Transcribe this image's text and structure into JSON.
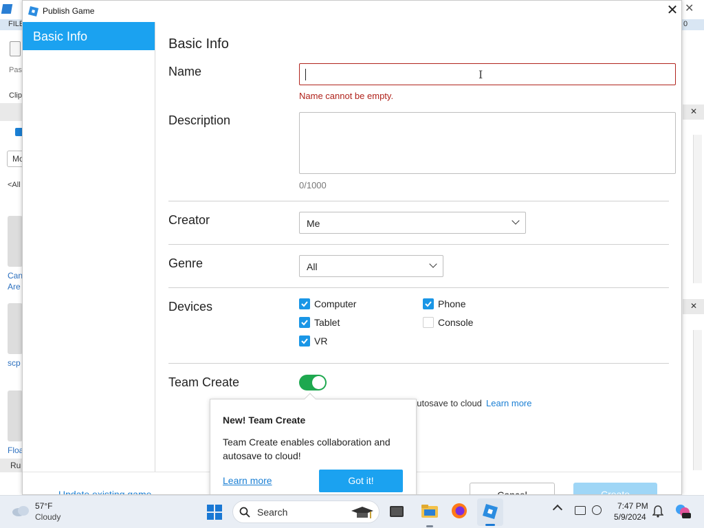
{
  "background": {
    "menu_file": "FILE",
    "paste": "Pas",
    "clipboard": "Clip",
    "mode": "Mo",
    "all": "<All",
    "item1": "Can",
    "item1b": "Are",
    "item2": "scp",
    "item3": "Floa",
    "run": "Ru",
    "right0": "0"
  },
  "dialog": {
    "title": "Publish Game",
    "sidebar": {
      "selected": "Basic Info"
    },
    "heading": "Basic Info",
    "name": {
      "label": "Name",
      "value": "",
      "error": "Name cannot be empty."
    },
    "description": {
      "label": "Description",
      "value": "",
      "counter": "0/1000"
    },
    "creator": {
      "label": "Creator",
      "value": "Me"
    },
    "genre": {
      "label": "Genre",
      "value": "All"
    },
    "devices": {
      "label": "Devices",
      "items": [
        {
          "label": "Computer",
          "checked": true
        },
        {
          "label": "Phone",
          "checked": true
        },
        {
          "label": "Tablet",
          "checked": true
        },
        {
          "label": "Console",
          "checked": false
        },
        {
          "label": "VR",
          "checked": true
        }
      ]
    },
    "team_create": {
      "label": "Team Create",
      "enabled": true,
      "hint": "autosave to cloud",
      "learn_more": "Learn more"
    },
    "popup": {
      "title": "New! Team Create",
      "body": "Team Create enables collaboration and autosave to cloud!",
      "learn_more": "Learn more",
      "got_it": "Got it!"
    },
    "footer": {
      "update_existing": "Update existing game",
      "cancel": "Cancel",
      "create": "Create"
    }
  },
  "taskbar": {
    "weather_temp": "57°F",
    "weather_desc": "Cloudy",
    "search": "Search",
    "time": "7:47 PM",
    "date": "5/9/2024"
  },
  "colors": {
    "accent": "#1ba2f0",
    "error": "#b0221b",
    "toggle": "#1ea84f"
  }
}
